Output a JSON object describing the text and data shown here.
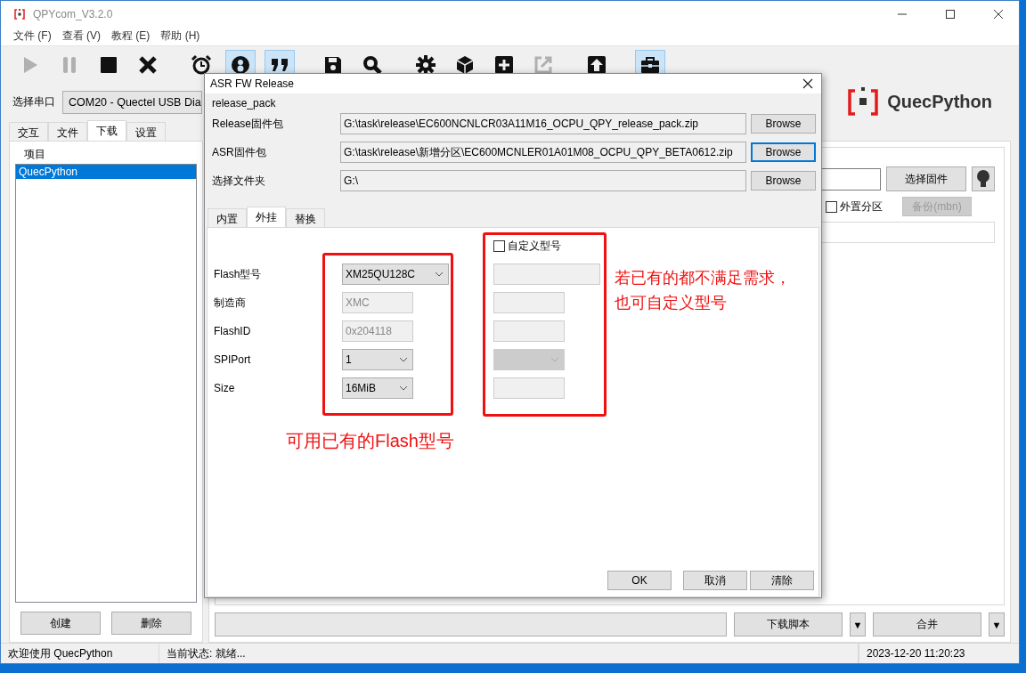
{
  "window": {
    "title": "QPYcom_V3.2.0"
  },
  "menu": [
    "文件 (F)",
    "查看 (V)",
    "教程 (E)",
    "帮助 (H)"
  ],
  "toolbar_groups": [
    {
      "buttons": [
        {
          "kind": "play",
          "disabled": true,
          "selected": false
        },
        {
          "kind": "pause",
          "disabled": true,
          "selected": false
        },
        {
          "kind": "stop",
          "disabled": false,
          "selected": false
        },
        {
          "kind": "cross",
          "disabled": false,
          "selected": false
        }
      ]
    },
    {
      "buttons": [
        {
          "kind": "alarm",
          "disabled": false,
          "selected": false
        },
        {
          "kind": "eight",
          "disabled": false,
          "selected": true
        },
        {
          "kind": "quote",
          "disabled": false,
          "selected": true
        }
      ]
    },
    {
      "buttons": [
        {
          "kind": "save",
          "disabled": false,
          "selected": false
        },
        {
          "kind": "search",
          "disabled": false,
          "selected": false
        }
      ]
    },
    {
      "buttons": [
        {
          "kind": "gear",
          "disabled": false,
          "selected": false
        },
        {
          "kind": "cube",
          "disabled": false,
          "selected": false
        },
        {
          "kind": "plus",
          "disabled": false,
          "selected": false
        },
        {
          "kind": "export",
          "disabled": true,
          "selected": false
        }
      ]
    },
    {
      "buttons": [
        {
          "kind": "upload",
          "disabled": false,
          "selected": false
        }
      ]
    },
    {
      "buttons": [
        {
          "kind": "toolbox",
          "disabled": false,
          "selected": true
        }
      ]
    }
  ],
  "port": {
    "label": "选择串口",
    "value": "COM20 - Quectel USB Dia"
  },
  "logo": {
    "text": "QuecPython"
  },
  "tabs": [
    {
      "label": "交互",
      "selected": false
    },
    {
      "label": "文件",
      "selected": false
    },
    {
      "label": "下载",
      "selected": true
    },
    {
      "label": "设置",
      "selected": false
    }
  ],
  "project": {
    "title": "项目",
    "items": [
      {
        "label": "QuecPython",
        "selected": true
      }
    ],
    "buttons": [
      "创建",
      "删除"
    ]
  },
  "firmware": {
    "button": "选择固件",
    "checkbox": {
      "label": "外置分区",
      "checked": false
    },
    "backup": {
      "label": "备份(mbn)",
      "disabled": true
    }
  },
  "bottom": {
    "buttons": [
      {
        "label": "下载脚本",
        "menu": "▼"
      },
      {
        "label": "合并",
        "menu": "▼"
      }
    ]
  },
  "status_bar": [
    "欢迎使用 QuecPython",
    "当前状态: 就绪...",
    "2023-12-20 11:20:23"
  ],
  "dialog": {
    "title": "ASR FW Release",
    "group": "release_pack",
    "files": [
      {
        "label": "Release固件包",
        "value": "G:\\task\\release\\EC600NCNLCR03A11M16_OCPU_QPY_release_pack.zip",
        "button": "Browse",
        "focused": false
      },
      {
        "label": "ASR固件包",
        "value": "G:\\task\\release\\新增分区\\EC600MCNLER01A01M08_OCPU_QPY_BETA0612.zip",
        "button": "Browse",
        "focused": true
      },
      {
        "label": "选择文件夹",
        "value": "G:\\",
        "button": "Browse",
        "focused": false
      }
    ],
    "tabs": [
      {
        "label": "内置",
        "selected": false
      },
      {
        "label": "外挂",
        "selected": true
      },
      {
        "label": "替换",
        "selected": false
      }
    ],
    "custom": {
      "label": "自定义型号",
      "checked": false
    },
    "rows": [
      {
        "label": "Flash型号",
        "kind": "select",
        "value": "XM25QU128C",
        "disabled": false,
        "wide": true,
        "custom": {
          "kind": "input"
        }
      },
      {
        "label": "制造商",
        "kind": "input",
        "value": "XMC",
        "disabled": true,
        "wide": false,
        "custom": {
          "kind": "input"
        }
      },
      {
        "label": "FlashID",
        "kind": "input",
        "value": "0x204118",
        "disabled": true,
        "wide": false,
        "custom": {
          "kind": "input"
        }
      },
      {
        "label": "SPIPort",
        "kind": "select",
        "value": "1",
        "disabled": false,
        "wide": false,
        "custom": {
          "kind": "select"
        }
      },
      {
        "label": "Size",
        "kind": "select",
        "value": "16MiB",
        "disabled": false,
        "wide": false,
        "custom": {
          "kind": "input"
        }
      }
    ],
    "annotations": [
      "可用已有的Flash型号",
      "若已有的都不满足需求，也可自定义型号"
    ],
    "buttons": [
      "OK",
      "取消",
      "清除"
    ]
  }
}
